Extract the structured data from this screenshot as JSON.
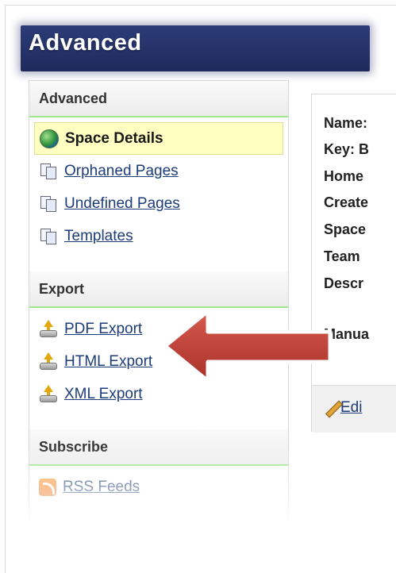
{
  "page": {
    "title": "Advanced"
  },
  "sidebar": {
    "sections": [
      {
        "heading": "Advanced",
        "items": [
          {
            "label": "Space Details",
            "icon": "globe-icon",
            "active": true
          },
          {
            "label": "Orphaned Pages",
            "icon": "pages-icon"
          },
          {
            "label": "Undefined Pages",
            "icon": "pages-icon"
          },
          {
            "label": "Templates",
            "icon": "pages-icon"
          }
        ]
      },
      {
        "heading": "Export",
        "items": [
          {
            "label": "PDF Export",
            "icon": "export-icon"
          },
          {
            "label": "HTML Export",
            "icon": "export-icon"
          },
          {
            "label": "XML Export",
            "icon": "export-icon"
          }
        ]
      },
      {
        "heading": "Subscribe",
        "items": [
          {
            "label": "RSS Feeds",
            "icon": "rss-icon"
          }
        ]
      }
    ]
  },
  "details": {
    "rows": [
      "Name:",
      "Key: B",
      "Home",
      "Create",
      "Space",
      "Team",
      "Descr",
      "Manua"
    ],
    "edit_label": "Edi"
  },
  "colors": {
    "title_bar": "#253369",
    "section_underline": "#9ee68c",
    "active_item": "#ffffc2",
    "link": "#1c3c7a",
    "callout": "#c0392b"
  }
}
